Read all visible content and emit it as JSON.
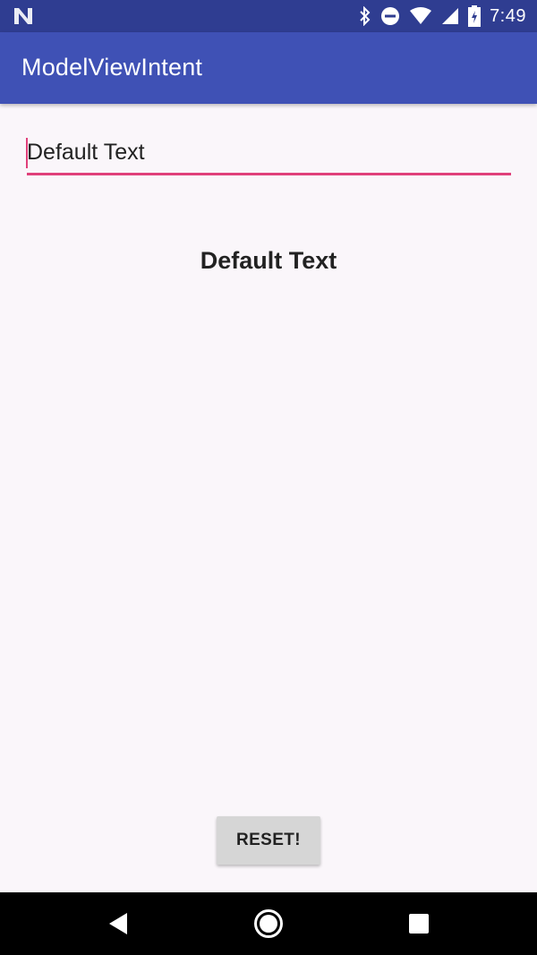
{
  "status_bar": {
    "time": "7:49",
    "icons": [
      "notification-n-icon",
      "bluetooth-icon",
      "do-not-disturb-icon",
      "wifi-icon",
      "signal-icon",
      "battery-icon"
    ]
  },
  "app_bar": {
    "title": "ModelViewIntent",
    "color": "#3f51b5"
  },
  "main": {
    "edit_text_value": "Default Text",
    "display_text": "Default Text",
    "reset_label": "RESET!",
    "accent_color": "#e0407a"
  },
  "nav_bar": {
    "icons": [
      "back-icon",
      "home-icon",
      "recents-icon"
    ]
  }
}
